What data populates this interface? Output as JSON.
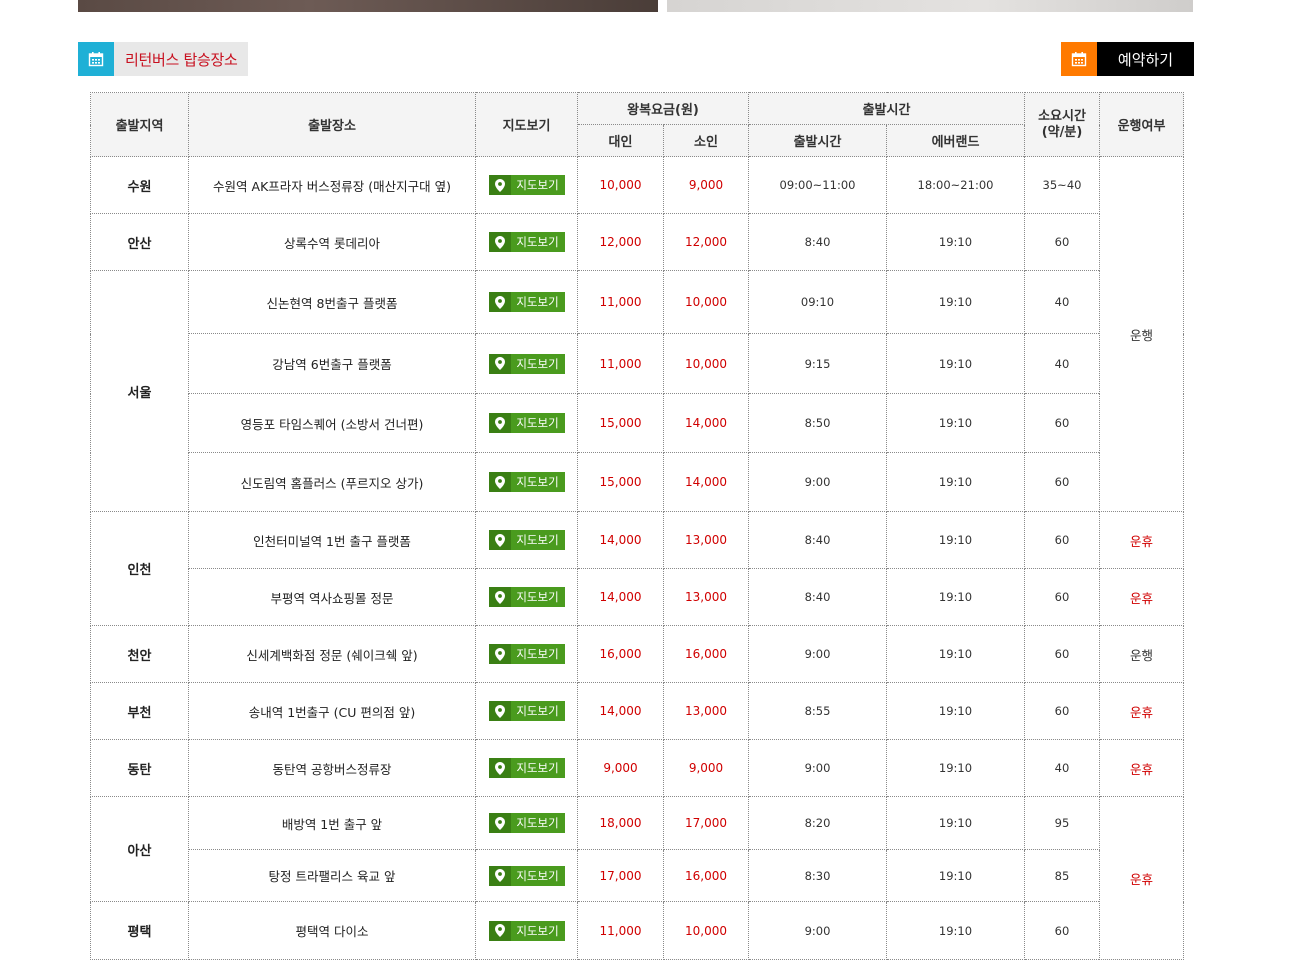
{
  "section_title": "리턴버스 탑승장소",
  "reserve_label": "예약하기",
  "colors": {
    "accent_blue": "#1fb0d6",
    "accent_orange": "#ff7a00",
    "fare_red": "#d00000",
    "status_red": "#d00000",
    "map_green": "#4a9b1e"
  },
  "headers": {
    "region": "출발지역",
    "place": "출발장소",
    "map": "지도보기",
    "fare": "왕복요금(원)",
    "adult": "대인",
    "child": "소인",
    "time": "출발시간",
    "depart": "출발시간",
    "everland": "에버랜드",
    "duration": "소요시간\n(약/분)",
    "status": "운행여부"
  },
  "map_label": "지도보기",
  "rows": [
    {
      "region": "수원",
      "place": "수원역 AK프라자 버스정류장 (매산지구대 옆)",
      "adult": "10,000",
      "child": "9,000",
      "depart": "09:00~11:00",
      "everland": "18:00~21:00",
      "duration": "35~40",
      "status": "운행"
    },
    {
      "region": "안산",
      "place": "상록수역 롯데리아",
      "adult": "12,000",
      "child": "12,000",
      "depart": "8:40",
      "everland": "19:10",
      "duration": "60"
    },
    {
      "region": "서울",
      "place": "신논현역 8번출구 플랫폼",
      "adult": "11,000",
      "child": "10,000",
      "depart": "09:10",
      "everland": "19:10",
      "duration": "40"
    },
    {
      "place": "강남역 6번출구 플랫폼",
      "adult": "11,000",
      "child": "10,000",
      "depart": "9:15",
      "everland": "19:10",
      "duration": "40"
    },
    {
      "place": "영등포 타임스퀘어 (소방서 건너편)",
      "adult": "15,000",
      "child": "14,000",
      "depart": "8:50",
      "everland": "19:10",
      "duration": "60"
    },
    {
      "place": "신도림역 홈플러스 (푸르지오 상가)",
      "adult": "15,000",
      "child": "14,000",
      "depart": "9:00",
      "everland": "19:10",
      "duration": "60"
    },
    {
      "region": "인천",
      "place": "인천터미널역 1번 출구 플랫폼",
      "adult": "14,000",
      "child": "13,000",
      "depart": "8:40",
      "everland": "19:10",
      "duration": "60",
      "status": "운휴"
    },
    {
      "place": "부평역 역사쇼핑몰 정문",
      "adult": "14,000",
      "child": "13,000",
      "depart": "8:40",
      "everland": "19:10",
      "duration": "60",
      "status": "운휴"
    },
    {
      "region": "천안",
      "place": "신세계백화점 정문 (쉐이크쉑 앞)",
      "adult": "16,000",
      "child": "16,000",
      "depart": "9:00",
      "everland": "19:10",
      "duration": "60",
      "status": "운행"
    },
    {
      "region": "부천",
      "place": "송내역 1번출구 (CU 편의점 앞)",
      "adult": "14,000",
      "child": "13,000",
      "depart": "8:55",
      "everland": "19:10",
      "duration": "60",
      "status": "운휴"
    },
    {
      "region": "동탄",
      "place": "동탄역 공항버스정류장",
      "adult": "9,000",
      "child": "9,000",
      "depart": "9:00",
      "everland": "19:10",
      "duration": "40",
      "status": "운휴"
    },
    {
      "region": "아산",
      "place": "배방역 1번 출구 앞",
      "adult": "18,000",
      "child": "17,000",
      "depart": "8:20",
      "everland": "19:10",
      "duration": "95",
      "status": "운휴"
    },
    {
      "place": "탕정 트라팰리스 육교 앞",
      "adult": "17,000",
      "child": "16,000",
      "depart": "8:30",
      "everland": "19:10",
      "duration": "85"
    },
    {
      "region": "평택",
      "place": "평택역 다이소",
      "adult": "11,000",
      "child": "10,000",
      "depart": "9:00",
      "everland": "19:10",
      "duration": "60"
    }
  ]
}
